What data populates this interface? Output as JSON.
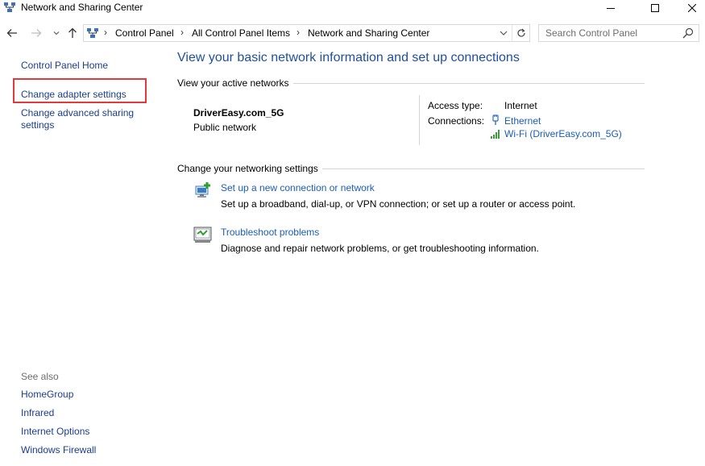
{
  "window": {
    "title": "Network and Sharing Center",
    "icon": "network-icon",
    "controls": [
      "minimize-icon",
      "maximize-icon",
      "close-icon"
    ]
  },
  "navigation": {
    "back_icon": "arrow-left-icon",
    "forward_icon": "arrow-right-icon",
    "recent_icon": "chevron-down-icon",
    "up_icon": "arrow-up-icon",
    "breadcrumbs": [
      "Control Panel",
      "All Control Panel Items",
      "Network and Sharing Center"
    ],
    "refresh_icon": "refresh-icon",
    "search_placeholder": "Search Control Panel"
  },
  "sidebar": {
    "home": "Control Panel Home",
    "change_adapter": "Change adapter settings",
    "change_advanced_line1": "Change advanced sharing",
    "change_advanced_line2": "settings",
    "see_also_title": "See also",
    "see_also": [
      "HomeGroup",
      "Infrared",
      "Internet Options",
      "Windows Firewall"
    ],
    "highlight_color": "#e03a3a"
  },
  "main": {
    "title": "View your basic network information and set up connections",
    "active_networks_heading": "View your active networks",
    "network": {
      "name": "DriverEasy.com_5G",
      "type": "Public network",
      "access_type_label": "Access type:",
      "access_type_value": "Internet",
      "connections_label": "Connections:",
      "connections": [
        {
          "label": "Ethernet",
          "icon": "ethernet-icon"
        },
        {
          "label": "Wi-Fi (DriverEasy.com_5G)",
          "icon": "wifi-signal-icon"
        }
      ]
    },
    "change_settings_heading": "Change your networking settings",
    "tasks": [
      {
        "link": "Set up a new connection or network",
        "desc": "Set up a broadband, dial-up, or VPN connection; or set up a router or access point.",
        "icon": "new-connection-icon"
      },
      {
        "link": "Troubleshoot problems",
        "desc": "Diagnose and repair network problems, or get troubleshooting information.",
        "icon": "troubleshoot-icon"
      }
    ]
  },
  "colors": {
    "link": "#1a5db8",
    "sidebar_link": "#1a3e8e",
    "title": "#1e4f9c"
  }
}
